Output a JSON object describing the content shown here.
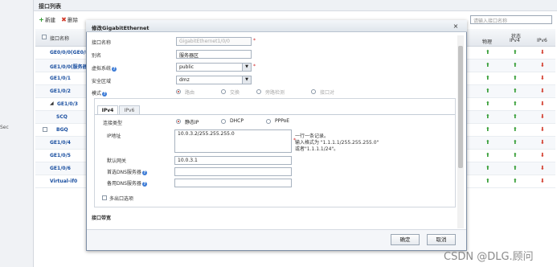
{
  "page": {
    "title": "接口列表"
  },
  "nav": {
    "partial_label": "Sec"
  },
  "toolbar": {
    "add_label": "新建",
    "delete_label": "删除"
  },
  "search": {
    "placeholder": "请输入接口名称"
  },
  "table": {
    "headers": {
      "name": "接口名称",
      "status": "状态",
      "physical": "物理",
      "ipv4": "IPv4",
      "ipv6": "IPv6"
    },
    "rows": [
      {
        "name": "GE0/0/0(GE0/M",
        "physical": "up",
        "ipv4": "up",
        "ipv6": "down",
        "checkbox": false,
        "indent": 0
      },
      {
        "name": "GE1/0/0(服务器",
        "physical": "up",
        "ipv4": "up",
        "ipv6": "down",
        "checkbox": false,
        "indent": 0
      },
      {
        "name": "GE1/0/1",
        "physical": "up",
        "ipv4": "up",
        "ipv6": "down",
        "checkbox": false,
        "indent": 0
      },
      {
        "name": "GE1/0/2",
        "physical": "up",
        "ipv4": "up",
        "ipv6": "down",
        "checkbox": false,
        "indent": 0
      },
      {
        "name": "GE1/0/3",
        "physical": "up",
        "ipv4": "up",
        "ipv6": "down",
        "checkbox": false,
        "indent": 0,
        "expanded": true
      },
      {
        "name": "SCQ",
        "physical": "up",
        "ipv4": "up",
        "ipv6": "down",
        "checkbox": true,
        "indent": 1
      },
      {
        "name": "BGQ",
        "physical": "up",
        "ipv4": "up",
        "ipv6": "down",
        "checkbox": true,
        "indent": 1
      },
      {
        "name": "GE1/0/4",
        "physical": "up",
        "ipv4": "up",
        "ipv6": "down",
        "checkbox": false,
        "indent": 0
      },
      {
        "name": "GE1/0/5",
        "physical": "up",
        "ipv4": "up",
        "ipv6": "down",
        "checkbox": false,
        "indent": 0
      },
      {
        "name": "GE1/0/6",
        "physical": "up",
        "ipv4": "up",
        "ipv6": "down",
        "checkbox": false,
        "indent": 0
      },
      {
        "name": "Virtual-if0",
        "physical": "up",
        "ipv4": "up",
        "ipv6": "down",
        "checkbox": false,
        "indent": 0
      }
    ]
  },
  "modal": {
    "title": "修改GigabitEthernet",
    "close_glyph": "×",
    "fields": {
      "interface_name": {
        "label": "接口名称",
        "value": "GigabitEthernet1/0/0"
      },
      "alias": {
        "label": "别名",
        "value": "服务器区"
      },
      "vsys": {
        "label": "虚拟系统",
        "value": "public"
      },
      "zone": {
        "label": "安全区域",
        "value": "dmz"
      },
      "mode": {
        "label": "模式",
        "options": [
          "路由",
          "交换",
          "旁路检测",
          "接口对"
        ],
        "selected": 0
      }
    },
    "tabs": [
      "IPv4",
      "IPv6"
    ],
    "ipv4": {
      "conn_type": {
        "label": "连接类型",
        "options": [
          "静态IP",
          "DHCP",
          "PPPoE"
        ],
        "selected": 0
      },
      "ip_address": {
        "label": "IP地址",
        "value": "10.0.3.2/255.255.255.0"
      },
      "ip_hint": [
        "一行一条记录。",
        "输入格式为 \"1.1.1.1/255.255.255.0\"",
        "或者\"1.1.1.1/24\"。"
      ],
      "gateway": {
        "label": "默认网关",
        "value": "10.0.3.1"
      },
      "dns1": {
        "label": "首选DNS服务器",
        "value": ""
      },
      "dns2": {
        "label": "备用DNS服务器",
        "value": ""
      },
      "multi_egress": {
        "label": "多出口选项"
      }
    },
    "section_bandwidth": "接口带宽",
    "ok_label": "确定",
    "cancel_label": "取消"
  },
  "watermark": "CSDN @DLG.顾问",
  "colors": {
    "status_up": "#2f9a2f",
    "status_down": "#d23a2a",
    "link_blue": "#1a4fa0",
    "required": "#d01f1f"
  }
}
